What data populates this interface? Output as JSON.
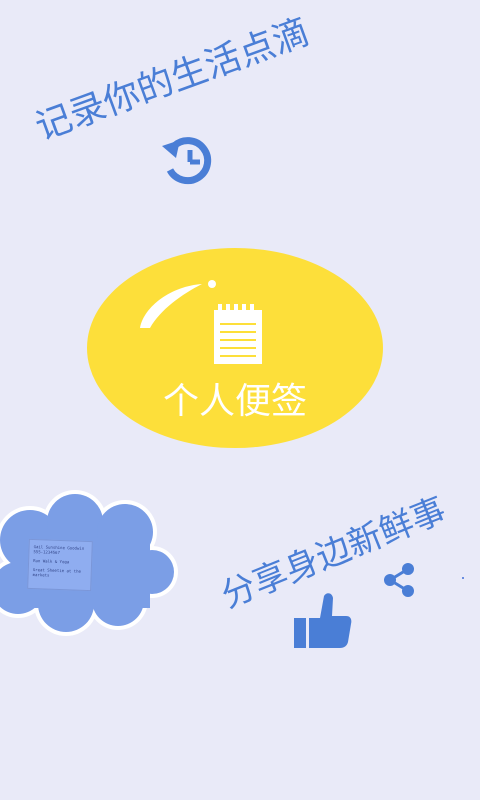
{
  "taglines": {
    "top": "记录你的生活点滴",
    "bottom": "分享身边新鲜事"
  },
  "center": {
    "label": "个人便签"
  },
  "note_paper": {
    "lines": [
      "Gail Sunshine Goodwin",
      "555-1234567",
      "Run Walk & Yoga",
      "Great Sheetie at the markets"
    ]
  },
  "icons": {
    "history": "history-clock-icon",
    "notepad": "notepad-icon",
    "share": "share-icon",
    "thumbs_up": "thumbs-up-icon"
  },
  "colors": {
    "background": "#e9eaf8",
    "accent_blue": "#4a7ed6",
    "ellipse_yellow": "#fddf3a",
    "cloud_blue": "#7b9ee6"
  }
}
